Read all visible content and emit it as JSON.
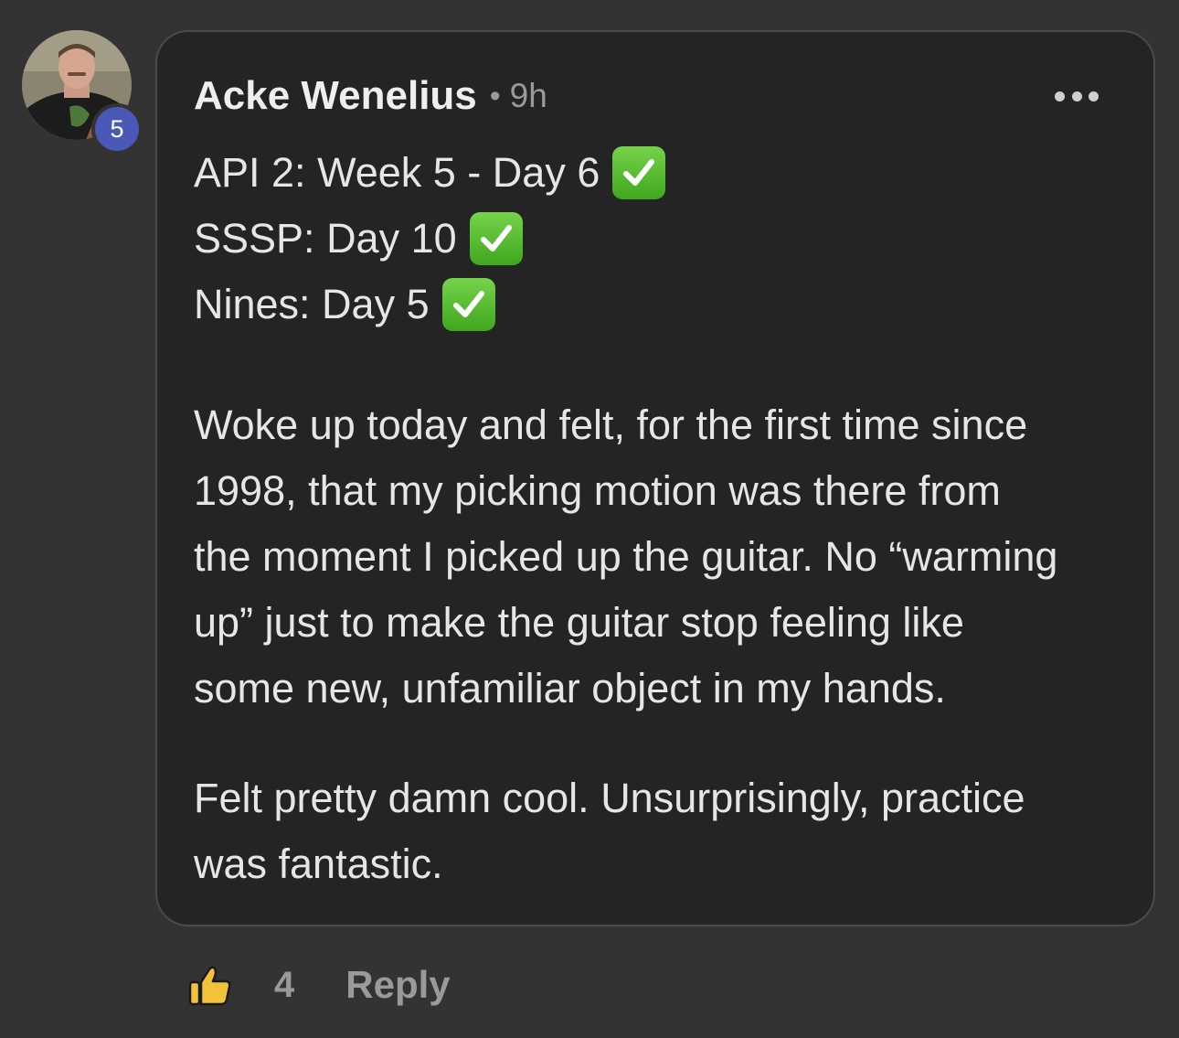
{
  "comment": {
    "author": "Acke Wenelius",
    "separator": "•",
    "time": "9h",
    "level": "5",
    "check_lines": [
      "API 2: Week 5 - Day 6",
      "SSSP: Day 10",
      "Nines: Day 5"
    ],
    "paragraph1_lines": [
      "Woke up today and felt, for the first time since",
      "1998, that my picking motion was there from",
      "the moment I picked up the guitar. No “warming",
      "up” just to make the guitar stop feeling like",
      "some new, unfamiliar object in my hands."
    ],
    "paragraph2_lines": [
      "Felt pretty damn cool. Unsurprisingly, practice",
      "was fantastic."
    ]
  },
  "actions": {
    "like_count": "4",
    "reply_label": "Reply"
  },
  "icons": {
    "more": "more-horizontal-icon",
    "like": "thumbs-up-icon",
    "check": "check-mark-button-icon"
  },
  "colors": {
    "background": "#333333",
    "bubble": "#242424",
    "badge": "#4a58b8",
    "check_green": "#56bf30"
  }
}
